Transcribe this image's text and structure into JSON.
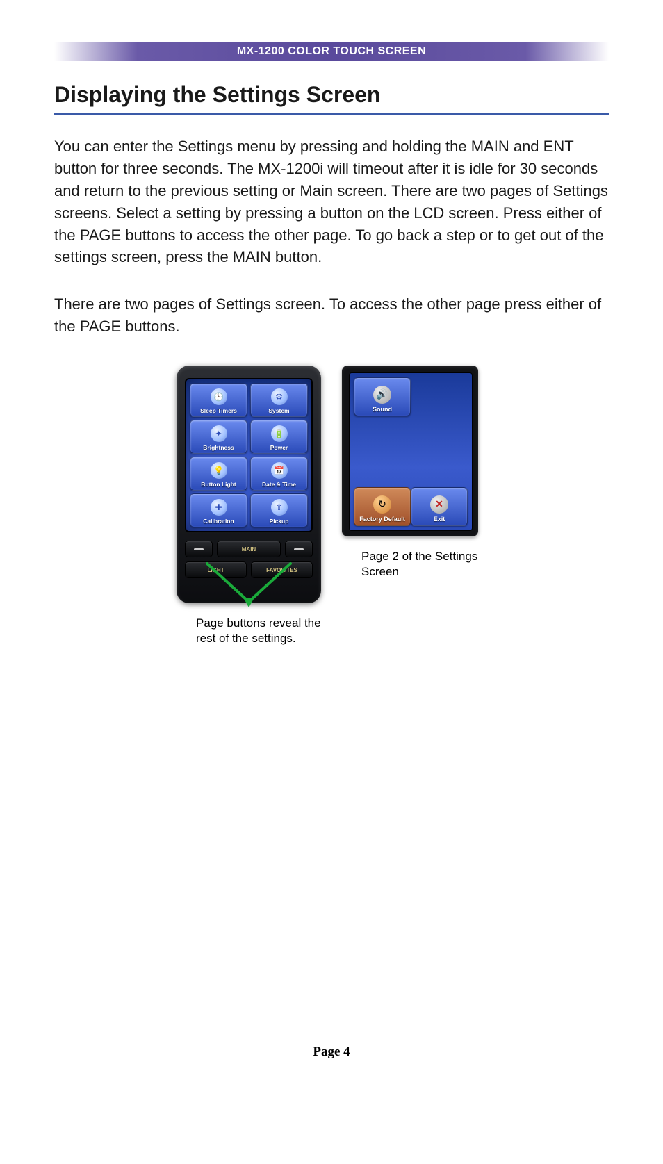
{
  "header": "MX-1200 COLOR TOUCH SCREEN",
  "section_title": "Displaying the Settings Screen",
  "para1": "You can enter the Settings menu by pressing and holding the MAIN and ENT button for three seconds. The MX-1200i will timeout after it is idle for 30 seconds and return to the previous setting or Main screen. There are two pages of Settings screens. Select a setting by pressing a button on the LCD screen. Press either of the PAGE buttons to access the other page. To go back a step or to get out of the settings screen, press the MAIN button.",
  "para2": "There are two pages of Settings screen. To access the other page press either of the PAGE buttons.",
  "page1": {
    "buttons": [
      {
        "label": "Sleep Timers",
        "icon": "🕒"
      },
      {
        "label": "System",
        "icon": "⚙"
      },
      {
        "label": "Brightness",
        "icon": "✦"
      },
      {
        "label": "Power",
        "icon": "🔋"
      },
      {
        "label": "Button Light",
        "icon": "💡"
      },
      {
        "label": "Date & Time",
        "icon": "📅"
      },
      {
        "label": "Calibration",
        "icon": "✚"
      },
      {
        "label": "Pickup",
        "icon": "⇧"
      }
    ],
    "hard": {
      "main": "MAIN",
      "light": "LIGHT",
      "favorites": "FAVORITES"
    }
  },
  "page2": {
    "sound": "Sound",
    "factory": "Factory Default",
    "exit": "Exit"
  },
  "caption1": "Page buttons reveal the rest of the settings.",
  "caption2": "Page 2 of the Settings Screen",
  "footer": "Page 4"
}
